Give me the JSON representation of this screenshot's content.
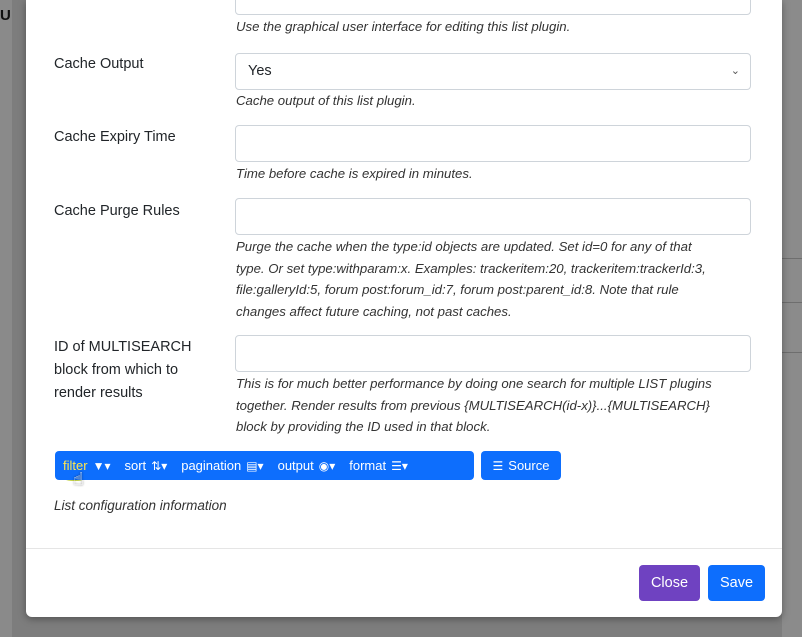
{
  "background": {
    "fragment_text": "U"
  },
  "form": {
    "gui_help": "Use the graphical user interface for editing this list plugin.",
    "cache_output": {
      "label": "Cache Output",
      "value": "Yes",
      "help": "Cache output of this list plugin."
    },
    "cache_expiry": {
      "label": "Cache Expiry Time",
      "value": "",
      "help": "Time before cache is expired in minutes."
    },
    "cache_purge": {
      "label": "Cache Purge Rules",
      "value": "",
      "help_lines": [
        "Purge the cache when the type:id objects are updated. Set id=0 for any of that",
        "type. Or set type:withparam:x. Examples: trackeritem:20, trackeritem:trackerId:3,",
        "file:galleryId:5, forum post:forum_id:7, forum post:parent_id:8. Note that rule",
        "changes affect future caching, not past caches."
      ]
    },
    "multisearch": {
      "label_lines": [
        "ID of MULTISEARCH",
        "block from which to",
        "render results"
      ],
      "value": "",
      "help_lines": [
        "This is for much better performance by doing one search for multiple LIST plugins",
        "together. Render results from previous {MULTISEARCH(id-x)}...{MULTISEARCH}",
        "block by providing the ID used in that block."
      ]
    }
  },
  "toolbar": {
    "filter": "filter",
    "sort": "sort",
    "pagination": "pagination",
    "output": "output",
    "format": "format",
    "source": "Source"
  },
  "config_info": "List configuration information",
  "footer": {
    "close": "Close",
    "save": "Save"
  },
  "colors": {
    "primary": "#0d6efd",
    "close_button": "#6f42c1",
    "filter_active": "#ffe84d"
  }
}
